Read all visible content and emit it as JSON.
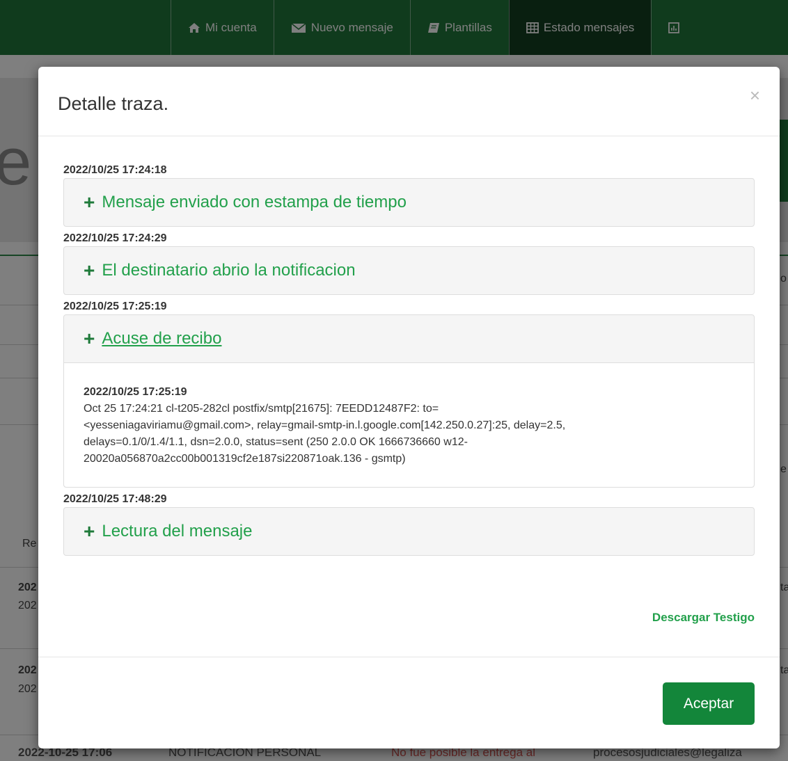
{
  "nav": {
    "items": [
      {
        "label": "Mi cuenta",
        "icon": "home-icon"
      },
      {
        "label": "Nuevo mensaje",
        "icon": "envelope-icon"
      },
      {
        "label": "Plantillas",
        "icon": "book-icon"
      },
      {
        "label": "Estado mensajes",
        "icon": "table-icon"
      }
    ]
  },
  "background": {
    "left_letter": "e",
    "left_cells": [
      "Re",
      "202",
      "202",
      "202",
      "202"
    ],
    "right_cells": [
      "o",
      "e",
      "ta",
      "ta"
    ],
    "bottom_row": {
      "date": "2022-10-25 17:06",
      "type": "NOTIFICACION PERSONAL",
      "status": "No fue posible la entrega al",
      "email": "procesosjudiciales@legaliza"
    }
  },
  "modal": {
    "title": "Detalle traza.",
    "close": "×",
    "events": [
      {
        "timestamp": "2022/10/25 17:24:18",
        "title": "Mensaje enviado con estampa de tiempo"
      },
      {
        "timestamp": "2022/10/25 17:24:29",
        "title": "El destinatario abrio la notificacion"
      },
      {
        "timestamp": "2022/10/25 17:25:19",
        "title": "Acuse de recibo",
        "detail": {
          "timestamp": "2022/10/25 17:25:19",
          "lines": [
            "Oct 25 17:24:21 cl-t205-282cl postfix/smtp[21675]: 7EEDD12487F2: to=",
            "<yesseniagaviriamu@gmail.com>, relay=gmail-smtp-in.l.google.com[142.250.0.27]:25, delay=2.5,",
            "delays=0.1/0/1.4/1.1, dsn=2.0.0, status=sent (250 2.0.0 OK 1666736660 w12-",
            "20020a056870a2cc00b001319cf2e187si220871oak.136 - gsmtp)"
          ]
        }
      },
      {
        "timestamp": "2022/10/25 17:48:29",
        "title": "Lectura del mensaje"
      }
    ],
    "download_label": "Descargar Testigo",
    "accept_label": "Aceptar"
  },
  "colors": {
    "navbar": "#21763a",
    "accent_green": "#22a04b",
    "button_green": "#13863a"
  }
}
